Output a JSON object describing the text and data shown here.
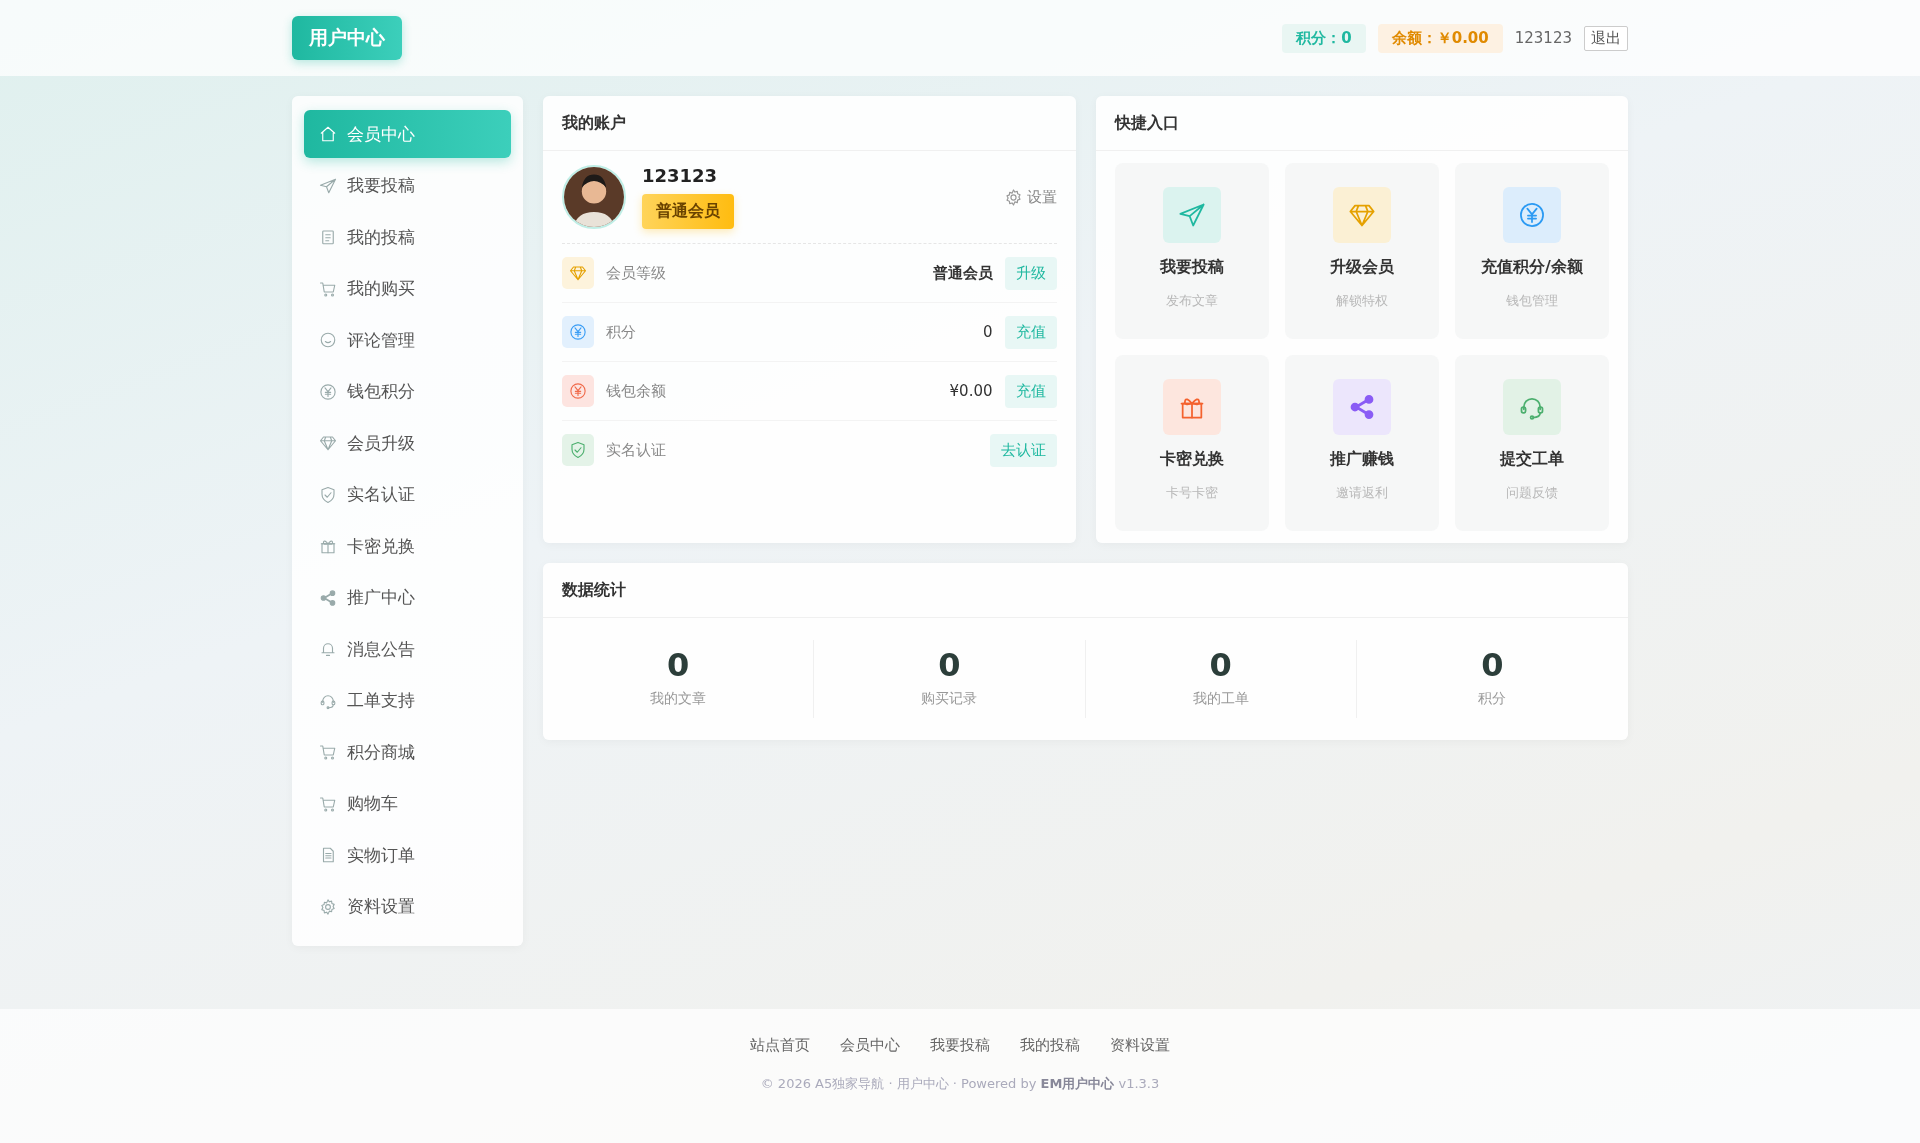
{
  "header": {
    "logo": "用户中心",
    "points": "积分：0",
    "balance": "余额：￥0.00",
    "username": "123123",
    "logout": "退出"
  },
  "sidebar": {
    "items": [
      {
        "label": "会员中心",
        "selected": true
      },
      {
        "label": "我要投稿",
        "selected": false
      },
      {
        "label": "我的投稿",
        "selected": false
      },
      {
        "label": "我的购买",
        "selected": false
      },
      {
        "label": "评论管理",
        "selected": false
      },
      {
        "label": "钱包积分",
        "selected": false
      },
      {
        "label": "会员升级",
        "selected": false
      },
      {
        "label": "实名认证",
        "selected": false
      },
      {
        "label": "卡密兑换",
        "selected": false
      },
      {
        "label": "推广中心",
        "selected": false
      },
      {
        "label": "消息公告",
        "selected": false
      },
      {
        "label": "工单支持",
        "selected": false
      },
      {
        "label": "积分商城",
        "selected": false
      },
      {
        "label": "购物车",
        "selected": false
      },
      {
        "label": "实物订单",
        "selected": false
      },
      {
        "label": "资料设置",
        "selected": false
      }
    ]
  },
  "account": {
    "title": "我的账户",
    "name": "123123",
    "level_badge": "普通会员",
    "settings": "设置",
    "rows": [
      {
        "label": "会员等级",
        "value": "普通会员",
        "action": "升级"
      },
      {
        "label": "积分",
        "value": "0",
        "action": "充值"
      },
      {
        "label": "钱包余额",
        "value": "¥0.00",
        "action": "充值"
      },
      {
        "label": "实名认证",
        "action": "去认证"
      }
    ]
  },
  "quick": {
    "title": "快捷入口",
    "entries": [
      {
        "title": "我要投稿",
        "subtitle": "发布文章"
      },
      {
        "title": "升级会员",
        "subtitle": "解锁特权"
      },
      {
        "title": "充值积分/余额",
        "subtitle": "钱包管理"
      },
      {
        "title": "卡密兑换",
        "subtitle": "卡号卡密"
      },
      {
        "title": "推广赚钱",
        "subtitle": "邀请返利"
      },
      {
        "title": "提交工单",
        "subtitle": "问题反馈"
      }
    ]
  },
  "stats": {
    "title": "数据统计",
    "items": [
      {
        "value": "0",
        "label": "我的文章"
      },
      {
        "value": "0",
        "label": "购买记录"
      },
      {
        "value": "0",
        "label": "我的工单"
      },
      {
        "value": "0",
        "label": "积分"
      }
    ]
  },
  "footer": {
    "links": [
      "站点首页",
      "会员中心",
      "我要投稿",
      "我的投稿",
      "资料设置"
    ],
    "copyright": "© 2026 A5独家导航 · 用户中心 · Powered by **EM用户中心** v1.3.3"
  }
}
